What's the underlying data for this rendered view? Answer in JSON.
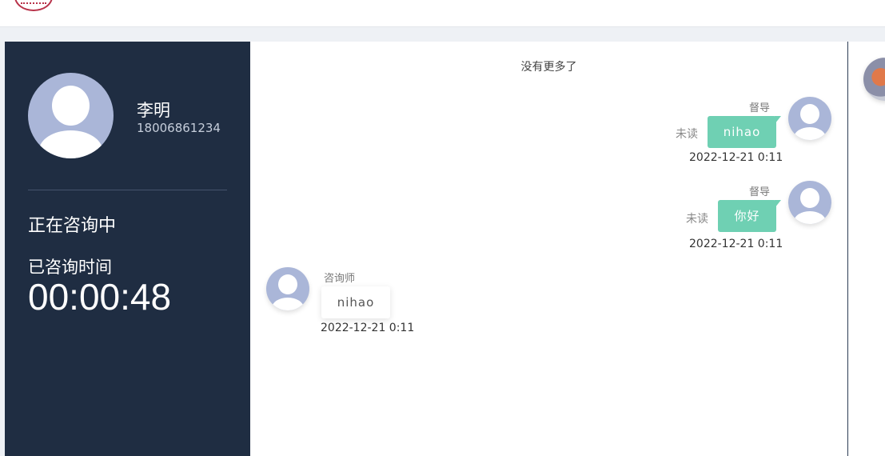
{
  "sidebar": {
    "user_name": "李明",
    "user_phone": "18006861234",
    "status": "正在咨询中",
    "elapsed_label": "已咨询时间",
    "elapsed_time": "00:00:48"
  },
  "chat": {
    "no_more": "没有更多了",
    "messages": [
      {
        "sender": "督导",
        "text": "nihao",
        "status": "未读",
        "time": "2022-12-21 0:11",
        "side": "right"
      },
      {
        "sender": "督导",
        "text": "你好",
        "status": "未读",
        "time": "2022-12-21 0:11",
        "side": "right"
      },
      {
        "sender": "咨询师",
        "text": "nihao",
        "time": "2022-12-21 0:11",
        "side": "left"
      }
    ]
  },
  "colors": {
    "sidebar_bg": "#1f2d42",
    "bubble_mine": "#6fd0b3",
    "avatar_bg": "#aab6d8"
  },
  "icons": {
    "logo": "school-seal-logo",
    "avatar": "default-user-avatar",
    "peer_avatar": "cartoon-fox-avatar"
  }
}
